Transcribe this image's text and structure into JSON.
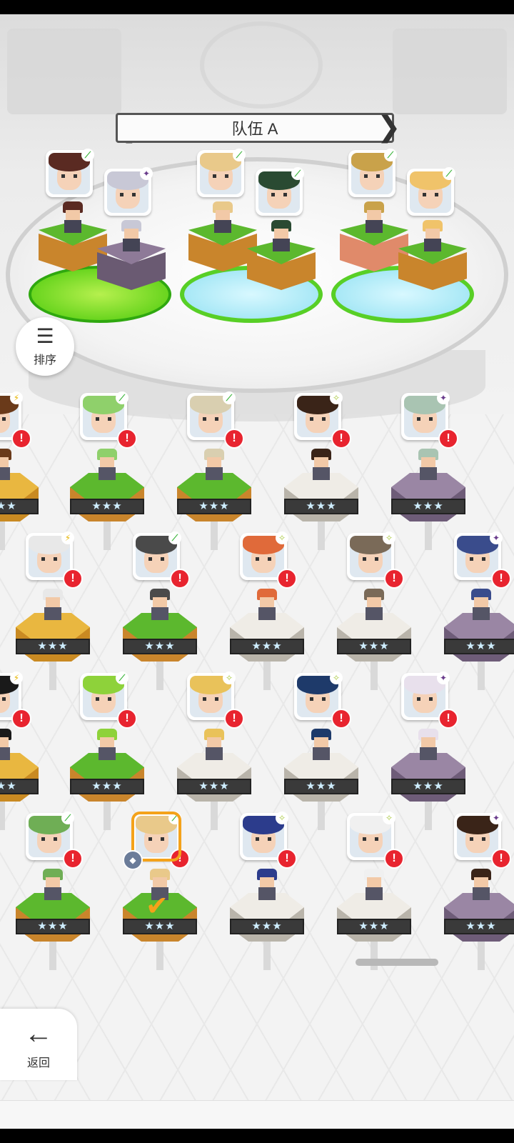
{
  "header": {
    "team_title": "队伍 A",
    "prev_arrow": "❮",
    "next_arrow": "❯"
  },
  "buttons": {
    "sort_label": "排序",
    "sort_icon": "sort-descending-icon",
    "back_label": "返回",
    "back_icon": "arrow-left-icon"
  },
  "stars": "★★★",
  "element_icons": {
    "leaf": "⟋",
    "bolt": "⚡",
    "sparkle": "✧",
    "dark": "✦"
  },
  "alert_mark": "!",
  "colors": {
    "alert": "#e8242f",
    "selected": "#f4a21a",
    "grass": "#5cb82e",
    "dirt": "#c9852c",
    "stone_purple": "#8e7a98",
    "stone_white": "#e9e6e0",
    "sand": "#e9b740"
  },
  "team_portraits": [
    {
      "hair": "#5a2a22",
      "element": "leaf"
    },
    {
      "hair": "#c8c8d6",
      "element": "dark"
    },
    {
      "hair": "#e9c98a",
      "element": "leaf"
    },
    {
      "hair": "#2a4a32",
      "element": "leaf"
    },
    {
      "hair": "#c9a24a",
      "element": "leaf"
    },
    {
      "hair": "#f0c36a",
      "element": "leaf"
    }
  ],
  "roster_rows": [
    [
      {
        "hair": "#6a3a1a",
        "element": "bolt",
        "base": "sand"
      },
      {
        "hair": "#8fd06b",
        "element": "leaf",
        "base": "grass"
      },
      {
        "hair": "#d9cfb0",
        "element": "leaf",
        "base": "grass"
      },
      {
        "hair": "#3a2418",
        "element": "sparkle",
        "base": "white"
      },
      {
        "hair": "#a9c4b2",
        "element": "dark",
        "base": "purple"
      }
    ],
    [
      {
        "hair": "#e8e8e8",
        "element": "bolt",
        "base": "sand"
      },
      {
        "hair": "#4a4a4a",
        "element": "leaf",
        "base": "grass"
      },
      {
        "hair": "#e06a3a",
        "element": "sparkle",
        "base": "white"
      },
      {
        "hair": "#7a6a58",
        "element": "sparkle",
        "base": "white"
      },
      {
        "hair": "#3a4c8c",
        "element": "dark",
        "base": "purple"
      }
    ],
    [
      {
        "hair": "#1a1a1a",
        "element": "bolt",
        "base": "sand"
      },
      {
        "hair": "#8ed23a",
        "element": "leaf",
        "base": "grass"
      },
      {
        "hair": "#e9c25a",
        "element": "sparkle",
        "base": "white"
      },
      {
        "hair": "#1e3a6a",
        "element": "sparkle",
        "base": "white"
      },
      {
        "hair": "#e8e0ec",
        "element": "dark",
        "base": "purple"
      }
    ],
    [
      {
        "hair": "#6fae55",
        "element": "leaf",
        "base": "grass"
      },
      {
        "hair": "#e9c98a",
        "element": "leaf",
        "base": "grass"
      },
      {
        "hair": "#2c3c8c",
        "element": "sparkle",
        "base": "white"
      },
      {
        "hair": "#f0f0f0",
        "element": "sparkle",
        "base": "white"
      },
      {
        "hair": "#3a2418",
        "element": "dark",
        "base": "purple"
      }
    ]
  ]
}
